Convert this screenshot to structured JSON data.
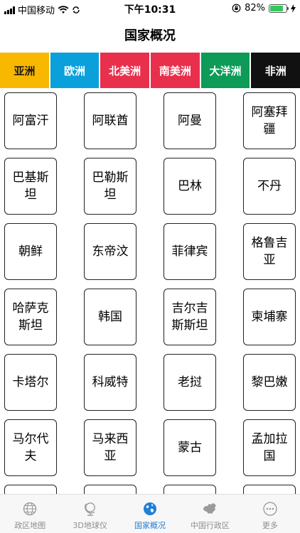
{
  "status": {
    "carrier": "中国移动",
    "time": "下午10:31",
    "battery": "82%",
    "battery_level": 0.82
  },
  "nav": {
    "title": "国家概况"
  },
  "colors": {
    "asia": "#f8b800",
    "europe": "#0aa0dc",
    "north_america": "#e8304c",
    "south_america": "#e8304c",
    "oceania": "#0e9a57",
    "africa": "#111111",
    "tab_active": "#1f7fd6"
  },
  "continents": [
    {
      "label": "亚洲",
      "active": true
    },
    {
      "label": "欧洲"
    },
    {
      "label": "北美洲"
    },
    {
      "label": "南美洲"
    },
    {
      "label": "大洋洲"
    },
    {
      "label": "非洲"
    }
  ],
  "countries": [
    "阿富汗",
    "阿联酋",
    "阿曼",
    "阿塞拜疆",
    "巴基斯坦",
    "巴勒斯坦",
    "巴林",
    "不丹",
    "朝鲜",
    "东帝汶",
    "菲律宾",
    "格鲁吉亚",
    "哈萨克斯坦",
    "韩国",
    "吉尔吉斯斯坦",
    "柬埔寨",
    "卡塔尔",
    "科威特",
    "老挝",
    "黎巴嫩",
    "马尔代夫",
    "马来西亚",
    "蒙古",
    "孟加拉国",
    "",
    "",
    "",
    ""
  ],
  "tabbar": [
    {
      "label": "政区地图",
      "icon": "globe-outline-icon"
    },
    {
      "label": "3D地球仪",
      "icon": "globe-stand-icon"
    },
    {
      "label": "国家概况",
      "icon": "globe-filled-icon",
      "active": true
    },
    {
      "label": "中国行政区",
      "icon": "china-map-icon"
    },
    {
      "label": "更多",
      "icon": "more-icon"
    }
  ]
}
